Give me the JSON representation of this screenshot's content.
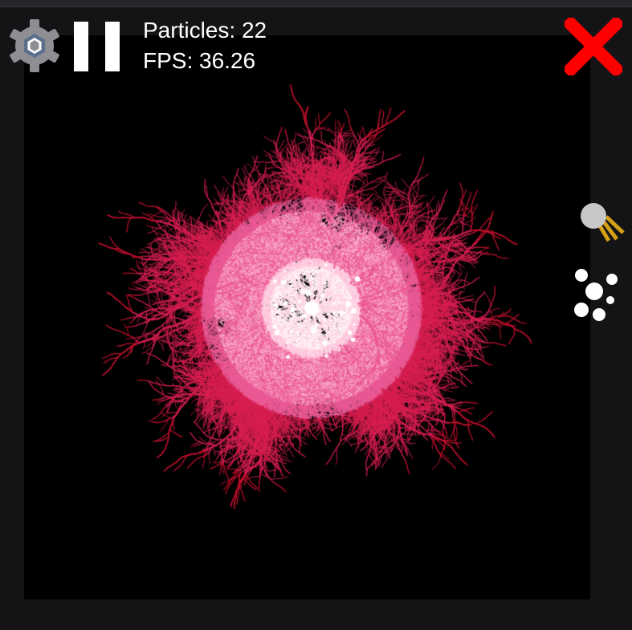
{
  "hud": {
    "particles_label": "Particles:",
    "particles_count": "22",
    "fps_label": "FPS:",
    "fps_value": "36.26"
  },
  "icons": {
    "settings": "gear-icon",
    "pause": "pause-icon",
    "close": "close-icon",
    "emitter": "particle-emitter-icon",
    "scatter": "particle-scatter-icon"
  },
  "colors": {
    "background": "#000000",
    "frame": "#141416",
    "branch_outer": "#c8102e",
    "branch_mid": "#e0245e",
    "branch_core": "#ffd6e6",
    "close_red": "#ff0000",
    "gear_gray": "#8e8f92",
    "emitter_rays": "#d4a017"
  }
}
